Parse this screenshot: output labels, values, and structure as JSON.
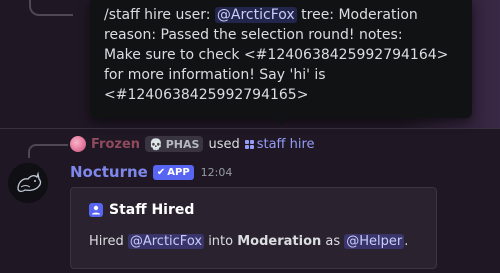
{
  "tooltip": {
    "line1_prefix": "/staff hire user: ",
    "line1_mention": "@ArcticFox",
    "line1_suffix": " tree: Moderation",
    "line2": "reason: Passed the selection round! notes:",
    "line3": "Make sure to check <#1240638425992794164>",
    "line4": "for more information! Say 'hi' is",
    "line5": "<#1240638425992794165>"
  },
  "reply": {
    "user": "Frozen",
    "tag": "PHAS",
    "tag_icon": "skull-icon",
    "used_text": "used",
    "command": "staff hire"
  },
  "message": {
    "bot_name": "Nocturne",
    "app_badge": "APP",
    "timestamp": "12:04"
  },
  "embed": {
    "title": "Staff Hired",
    "desc_hired": "Hired ",
    "desc_user": "@ArcticFox",
    "desc_into": " into ",
    "desc_tree": "Moderation",
    "desc_as": " as ",
    "desc_role": "@Helper",
    "desc_end": "."
  },
  "colors": {
    "background": "#1f1724",
    "accent": "#5865f2",
    "bot_name": "#7f88ea",
    "tooltip_bg": "#111214"
  }
}
